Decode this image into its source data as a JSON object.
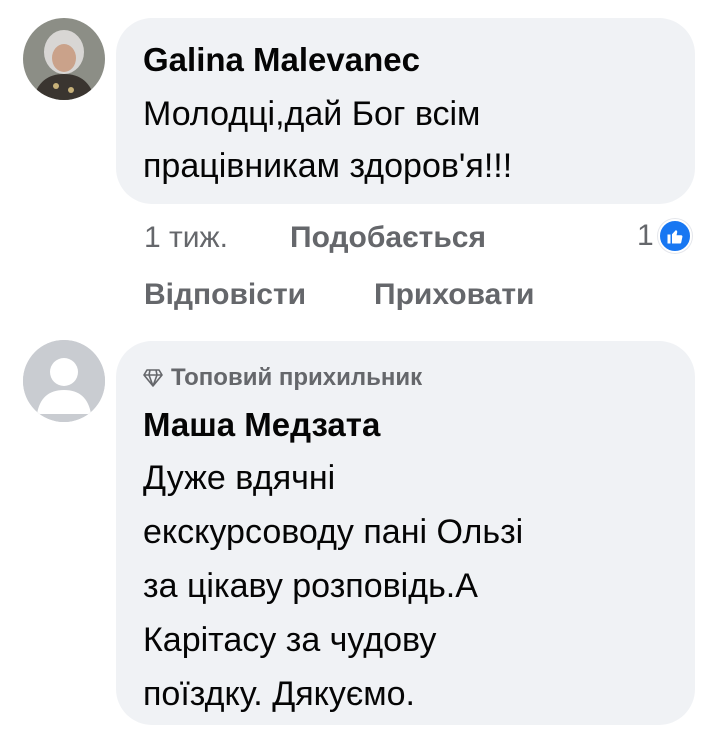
{
  "comments": [
    {
      "author": "Galina Malevanec",
      "text_lines": [
        "Молодці,дай Бог всім",
        "працівникам здоров'я!!!"
      ],
      "time": "1 тиж.",
      "like_action": "Подобається",
      "reply_action": "Відповісти",
      "hide_action": "Приховати",
      "reaction_count": "1",
      "reaction_icon": "thumbs-up-icon"
    },
    {
      "badge_label": "Топовий прихильник",
      "badge_icon": "diamond-icon",
      "author": "Маша Медзата",
      "text_lines": [
        "Дуже вдячні",
        "екскурсоводу пані Ользі",
        "за цікаву розповідь.А",
        "Карітасу за чудову",
        "поїздку. Дякуємо."
      ]
    }
  ],
  "colors": {
    "bubble": "#f0f2f5",
    "text": "#050505",
    "secondary": "#65676b",
    "like_blue": "#1877f2"
  }
}
